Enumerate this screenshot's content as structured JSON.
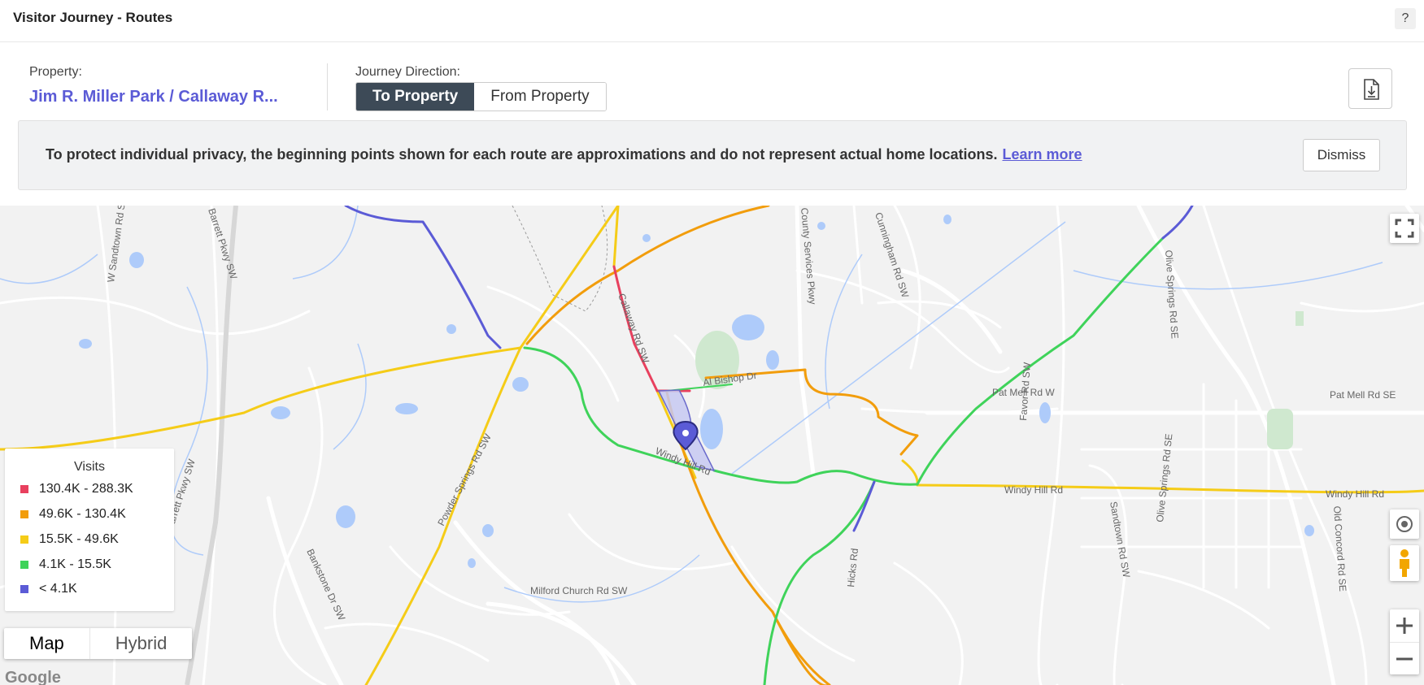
{
  "header": {
    "title": "Visitor Journey - Routes",
    "help_label": "?"
  },
  "controls": {
    "property_label": "Property:",
    "property_value": "Jim R. Miller Park / Callaway R...",
    "direction_label": "Journey Direction:",
    "direction_options": [
      "To Property",
      "From Property"
    ],
    "direction_selected": "To Property"
  },
  "notice": {
    "message": "To protect individual privacy, the beginning points shown for each route are approximations and do not represent actual home locations.",
    "learn_more": "Learn more",
    "dismiss": "Dismiss"
  },
  "legend": {
    "title": "Visits",
    "items": [
      {
        "label": "130.4K - 288.3K",
        "color": "#e8405e"
      },
      {
        "label": "49.6K - 130.4K",
        "color": "#f29d0c"
      },
      {
        "label": "15.5K - 49.6K",
        "color": "#f5cc18"
      },
      {
        "label": "4.1K - 15.5K",
        "color": "#3fd35a"
      },
      {
        "label": "< 4.1K",
        "color": "#5b5bd6"
      }
    ]
  },
  "map_type": {
    "options": [
      "Map",
      "Hybrid"
    ],
    "selected": "Map"
  },
  "map_labels": {
    "windy_hill_1": "Windy Hill Rd",
    "windy_hill_2": "Windy Hill Rd",
    "windy_hill_3": "Windy Hill Rd",
    "pat_mell_w": "Pat Mell Rd W",
    "pat_mell_se": "Pat Mell Rd SE",
    "al_bishop": "Al Bishop Dr",
    "callaway": "Callaway Rd SW",
    "powder_springs": "Powder Springs Rd SW",
    "milford_church": "Milford Church Rd SW",
    "sandtown": "W Sandtown Rd SW",
    "barrett_1": "Barrett Pkwy SW",
    "barrett_2": "Barrett Pkwy SW",
    "county_services": "County Services Pkwy",
    "cunningham": "Cunningham Rd SW",
    "olive_springs_1": "Olive Springs Rd SE",
    "olive_springs_2": "Olive Springs Rd SE",
    "favor": "Favor Rd SW",
    "hicks": "Hicks Rd",
    "bankstone": "Bankstone Dr SW",
    "sandtown_2": "Sandtown Rd SW",
    "old_concord": "Old Concord Rd SE",
    "google": "Google"
  },
  "icons": [
    "download-icon",
    "location-pin-icon",
    "fullscreen-icon",
    "my-location-icon",
    "pegman-icon",
    "zoom-in-icon",
    "zoom-out-icon"
  ]
}
